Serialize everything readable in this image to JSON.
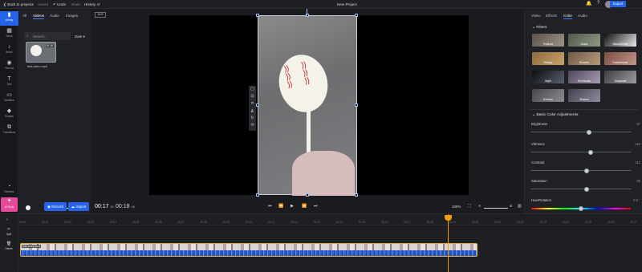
{
  "topbar": {
    "back": "Back to projects",
    "saved": "Saved",
    "undo": "Undo",
    "redo": "Redo",
    "history": "History",
    "title": "New Project",
    "export": "Export"
  },
  "rail": {
    "items": [
      {
        "label": "Library",
        "icon": "folder-icon"
      },
      {
        "label": "Stock",
        "icon": "grid-icon"
      },
      {
        "label": "Audio",
        "icon": "music-icon"
      },
      {
        "label": "Record",
        "icon": "record-icon"
      },
      {
        "label": "Text",
        "icon": "text-icon"
      },
      {
        "label": "Subtitles",
        "icon": "subtitles-icon"
      },
      {
        "label": "Shapes",
        "icon": "shapes-icon"
      },
      {
        "label": "Transitions",
        "icon": "transitions-icon"
      },
      {
        "label": "Reviews",
        "icon": "reviews-icon"
      },
      {
        "label": "AI Tools",
        "icon": "ai-icon"
      }
    ]
  },
  "media": {
    "tabs": [
      "All",
      "Videos",
      "Audio",
      "Images"
    ],
    "search_placeholder": "Search...",
    "sort": "Date",
    "file": {
      "name": "test-video.mp4",
      "duration": "00:18"
    }
  },
  "player": {
    "aspect": "16:9",
    "current": "00:17",
    "current_frac": "81",
    "total": "00:18",
    "total_frac": "06",
    "zoom": "100%",
    "record": "Record",
    "import": "Import"
  },
  "right": {
    "tabs": [
      "Video",
      "Effects",
      "Color",
      "Audio"
    ],
    "filters_title": "Filters",
    "filters": [
      "Polaroid",
      "Grass",
      "Black&White",
      "Vintage",
      "Brownie",
      "Kodachrome",
      "Night",
      "Technicolor",
      "Grayscale",
      "Emboss",
      "Shaded"
    ],
    "adjust_title": "Basic Color Adjustments",
    "adjustments": [
      {
        "label": "Brightness",
        "value": "97",
        "level": 0.58
      },
      {
        "label": "Vibrance",
        "value": "116",
        "level": 0.6
      },
      {
        "label": "Contrast",
        "value": "111",
        "level": 0.56
      },
      {
        "label": "Saturation",
        "value": "95",
        "level": 0.56
      },
      {
        "label": "Hue/Rotation",
        "value": "0.5 °",
        "level": 0.5
      }
    ]
  },
  "timeline": {
    "ticks": [
      "00:00",
      "00:01",
      "00:02",
      "00:03",
      "00:04",
      "00:05",
      "00:06",
      "00:07",
      "00:08",
      "00:09",
      "00:10",
      "00:11",
      "00:12",
      "00:13",
      "00:14",
      "00:15",
      "00:16",
      "00:17",
      "00:18",
      "00:19",
      "00:20",
      "00:21",
      "00:22",
      "00:23",
      "00:24",
      "00:25",
      "00:26",
      "00:27"
    ],
    "clip_label": "test-video.mp4",
    "tools": [
      "Split",
      "Delete"
    ]
  }
}
